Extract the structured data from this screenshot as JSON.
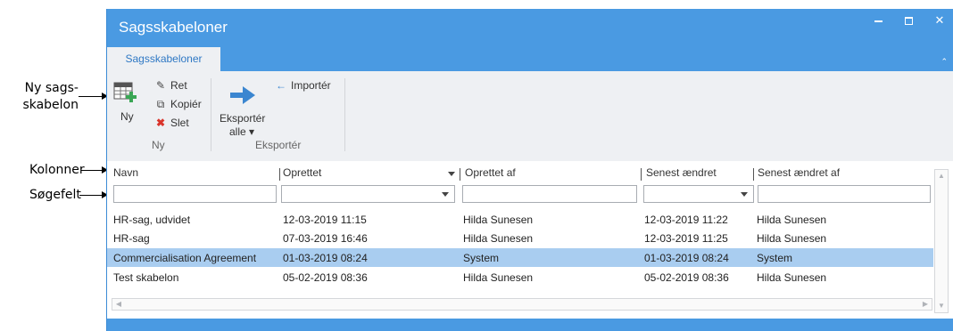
{
  "annotations": {
    "new_template": "Ny sags-\nskabelon",
    "columns": "Kolonner",
    "search_field": "Søgefelt"
  },
  "window": {
    "title": "Sagsskabeloner",
    "controls": {
      "minimize_icon": "minimize-icon",
      "maximize_icon": "maximize-icon",
      "close_icon": "close-icon",
      "close_glyph": "✕"
    }
  },
  "tabs": [
    {
      "label": "Sagsskabeloner",
      "active": true
    }
  ],
  "ribbon": {
    "collapse_glyph": "⌃",
    "groups": {
      "ny": {
        "label": "Ny",
        "new_button": "Ny",
        "ret_button": "Ret",
        "kopier_button": "Kopiér",
        "slet_button": "Slet"
      },
      "eksporter": {
        "label": "Eksportér",
        "export_all_line1": "Eksportér",
        "export_all_line2": "alle ▾",
        "import_button": "Importér"
      }
    }
  },
  "grid": {
    "columns": [
      "Navn",
      "Oprettet",
      "Oprettet af",
      "Senest ændret",
      "Senest ændret af"
    ],
    "filters": [
      "",
      "",
      "",
      "",
      ""
    ],
    "rows": [
      {
        "navn": "HR-sag, udvidet",
        "oprettet": "12-03-2019 11:15",
        "oprettet_af": "Hilda Sunesen",
        "senest_aendret": "12-03-2019 11:22",
        "senest_aendret_af": "Hilda Sunesen",
        "selected": false
      },
      {
        "navn": "HR-sag",
        "oprettet": "07-03-2019 16:46",
        "oprettet_af": "Hilda Sunesen",
        "senest_aendret": "12-03-2019 11:25",
        "senest_aendret_af": "Hilda Sunesen",
        "selected": false
      },
      {
        "navn": "Commercialisation Agreement",
        "oprettet": "01-03-2019 08:24",
        "oprettet_af": "System",
        "senest_aendret": "01-03-2019 08:24",
        "senest_aendret_af": "System",
        "selected": true
      },
      {
        "navn": "Test skabelon",
        "oprettet": "05-02-2019 08:36",
        "oprettet_af": "Hilda Sunesen",
        "senest_aendret": "05-02-2019 08:36",
        "senest_aendret_af": "Hilda Sunesen",
        "selected": false
      }
    ]
  },
  "colors": {
    "accent": "#4a9ae2",
    "ribbon_bg": "#eef0f3",
    "selected_row": "#a9cdf0",
    "delete_red": "#d9342b",
    "arrow_blue": "#3b86d0"
  }
}
